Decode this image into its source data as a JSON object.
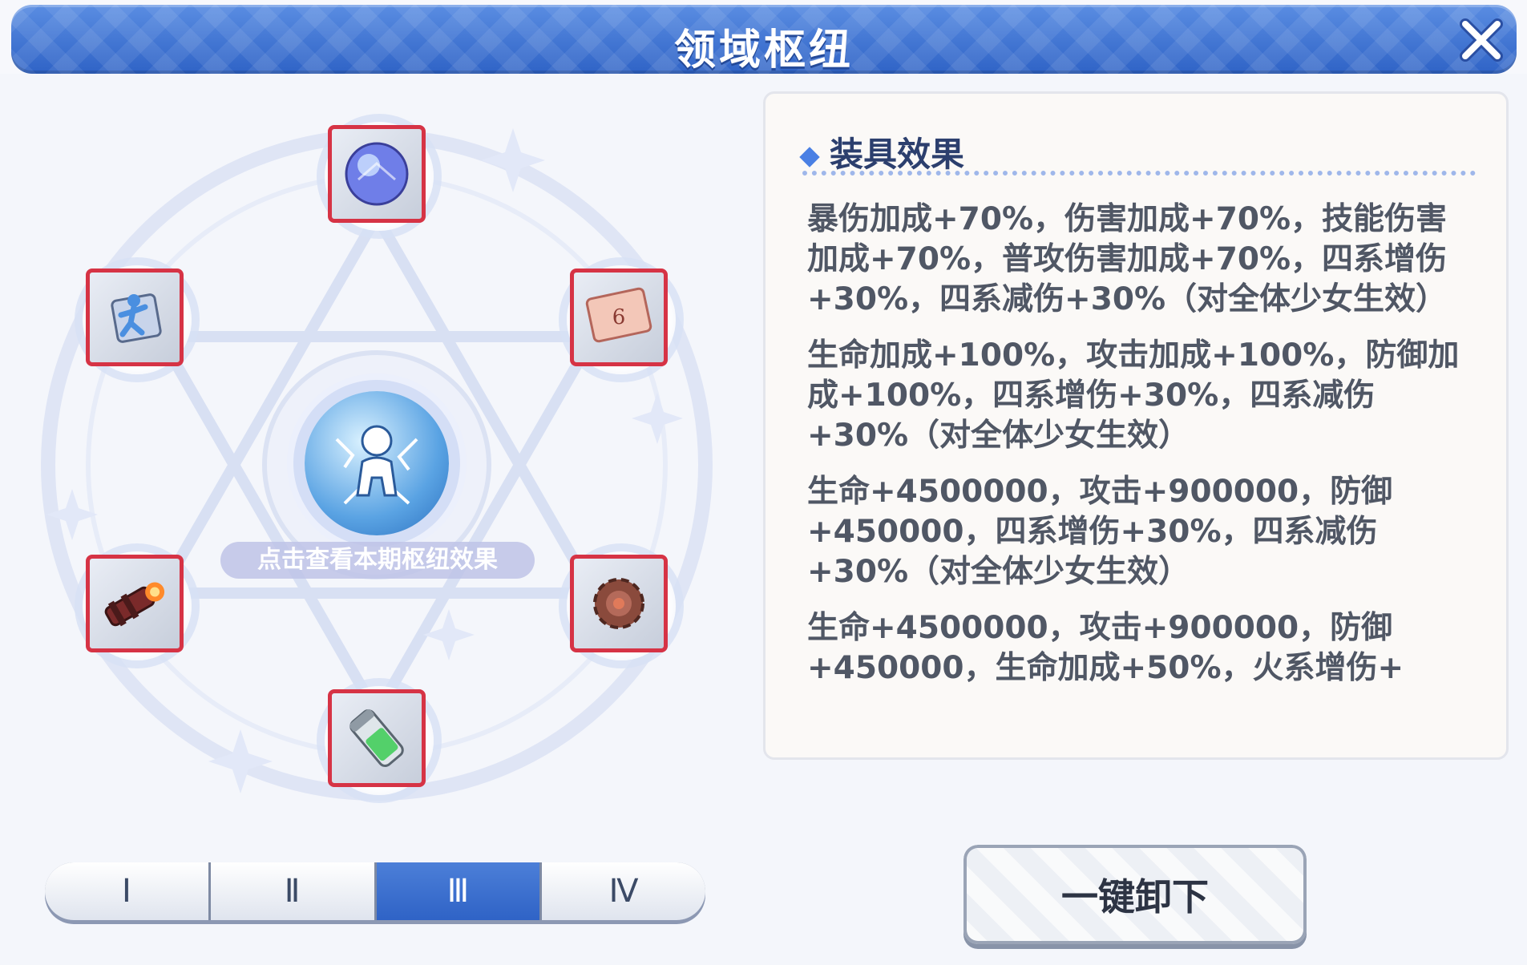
{
  "window": {
    "title": "领域枢纽"
  },
  "center": {
    "label": "点击查看本期枢纽效果"
  },
  "slots": [
    {
      "name": "crystal-orb-slot",
      "icon": "crystal-orb-icon"
    },
    {
      "name": "dice-card-slot",
      "icon": "dice-card-icon"
    },
    {
      "name": "gear-slot",
      "icon": "gear-icon"
    },
    {
      "name": "green-capsule-slot",
      "icon": "green-capsule-icon"
    },
    {
      "name": "rocket-cannon-slot",
      "icon": "rocket-cannon-icon"
    },
    {
      "name": "running-figure-slot",
      "icon": "running-figure-icon"
    }
  ],
  "tabs": [
    {
      "label": "Ⅰ",
      "active": false
    },
    {
      "label": "Ⅱ",
      "active": false
    },
    {
      "label": "Ⅲ",
      "active": true
    },
    {
      "label": "Ⅳ",
      "active": false
    }
  ],
  "panel": {
    "heading": "装具效果",
    "effects": [
      "暴伤加成+70%，伤害加成+70%，技能伤害加成+70%，普攻伤害加成+70%，四系增伤+30%，四系减伤+30%（对全体少女生效）",
      "生命加成+100%，攻击加成+100%，防御加成+100%，四系增伤+30%，四系减伤+30%（对全体少女生效）",
      "生命+4500000，攻击+900000，防御+450000，四系增伤+30%，四系减伤+30%（对全体少女生效）",
      "生命+4500000，攻击+900000，防御+450000，生命加成+50%，火系增伤+"
    ]
  },
  "actions": {
    "unequip_all": "一键卸下"
  },
  "colors": {
    "title_bar": "#2f63c6",
    "slot_border": "#d63345",
    "active_tab": "#2f63c6",
    "heading": "#2c3f6e"
  }
}
